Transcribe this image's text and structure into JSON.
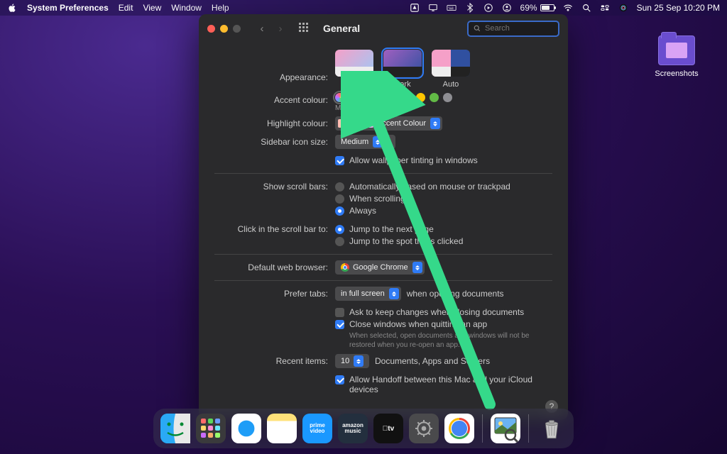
{
  "menubar": {
    "app_name": "System Preferences",
    "menus": [
      "Edit",
      "View",
      "Window",
      "Help"
    ],
    "battery_pct": "69%",
    "datetime": "Sun 25 Sep  10:20 PM"
  },
  "desktop": {
    "folder_label": "Screenshots"
  },
  "window": {
    "title": "General",
    "search_placeholder": "Search",
    "appearance": {
      "label": "Appearance:",
      "options": [
        "Light",
        "Dark",
        "Auto"
      ],
      "selected": "Dark"
    },
    "accent": {
      "label": "Accent colour:",
      "sublabel": "Multicolour",
      "colors": [
        "#ff5f57",
        "#ff9500",
        "#ffcc00",
        "#28cd41",
        "#007aff",
        "#5856d6",
        "#ff2d55",
        "#8e8e93"
      ],
      "selected_index": 0
    },
    "highlight": {
      "label": "Highlight colour:",
      "value": "Accent Colour"
    },
    "sidebar": {
      "label": "Sidebar icon size:",
      "value": "Medium"
    },
    "wallpaper_tint": {
      "label": "Allow wallpaper tinting in windows",
      "checked": true
    },
    "scrollbars": {
      "label": "Show scroll bars:",
      "options": [
        "Automatically based on mouse or trackpad",
        "When scrolling",
        "Always"
      ],
      "selected": "Always"
    },
    "click_scroll": {
      "label": "Click in the scroll bar to:",
      "options": [
        "Jump to the next page",
        "Jump to the spot that's clicked"
      ],
      "selected": "Jump to the next page"
    },
    "browser": {
      "label": "Default web browser:",
      "value": "Google Chrome"
    },
    "tabs": {
      "label": "Prefer tabs:",
      "value": "in full screen",
      "suffix": "when opening documents"
    },
    "ask_keep": {
      "label": "Ask to keep changes when closing documents",
      "checked": false
    },
    "close_windows": {
      "label": "Close windows when quitting an app",
      "hint": "When selected, open documents and windows will not be restored when you re-open an app.",
      "checked": true
    },
    "recent": {
      "label": "Recent items:",
      "value": "10",
      "suffix": "Documents, Apps and Servers"
    },
    "handoff": {
      "label": "Allow Handoff between this Mac and your iCloud devices",
      "checked": true
    }
  },
  "dock": {
    "apps": [
      "Finder",
      "Launchpad",
      "Safari",
      "Notes",
      "Prime Video",
      "Amazon Music",
      "Apple TV",
      "System Settings",
      "Google Chrome",
      "Preview",
      "Trash"
    ]
  }
}
